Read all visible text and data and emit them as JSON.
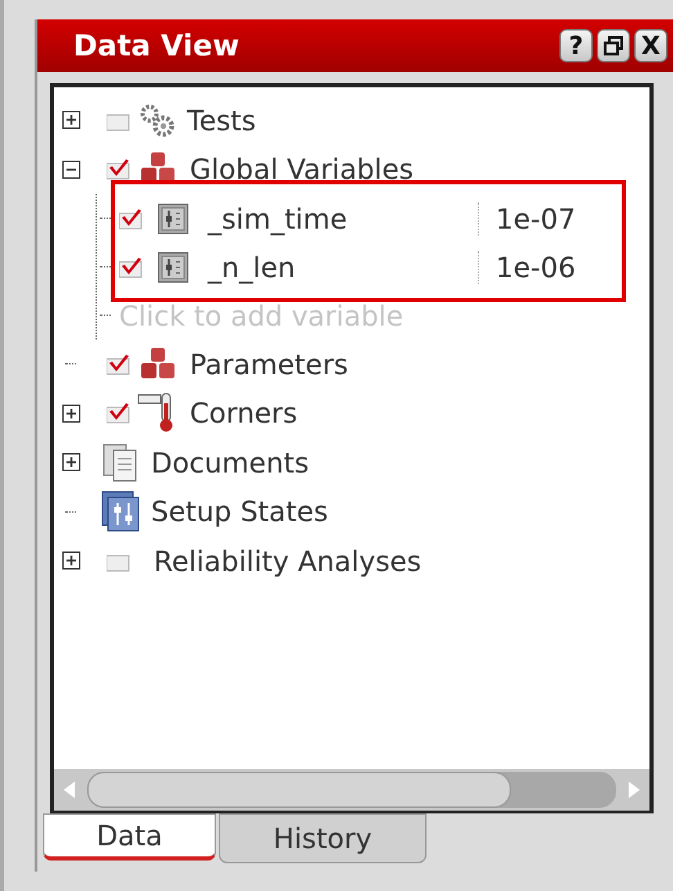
{
  "window": {
    "title": "Data View",
    "controls": [
      {
        "kind": "help",
        "label": "?"
      },
      {
        "kind": "restore"
      },
      {
        "kind": "close",
        "label": "X"
      }
    ]
  },
  "tree": {
    "items": [
      {
        "kind": "gears",
        "label": "Tests",
        "expanded": false,
        "checked": false
      },
      {
        "kind": "cubes",
        "label": "Global Variables",
        "expanded": true,
        "checked": true,
        "children": [
          {
            "kind": "variable",
            "label": "_sim_time",
            "value": "1e-07",
            "checked": true
          },
          {
            "kind": "variable",
            "label": "_n_len",
            "value": "1e-06",
            "checked": true
          },
          {
            "kind": "hint",
            "label": "Click to add variable"
          }
        ]
      },
      {
        "kind": "cubes",
        "label": "Parameters",
        "checked": true
      },
      {
        "kind": "thermometer",
        "label": "Corners",
        "expanded": false,
        "checked": true
      },
      {
        "kind": "documents",
        "label": "Documents",
        "expanded": false
      },
      {
        "kind": "setup",
        "label": "Setup States"
      },
      {
        "kind": "none",
        "label": "Reliability Analyses",
        "expanded": false,
        "checked": false
      }
    ]
  },
  "tabs": [
    {
      "label": "Data",
      "selected": true
    },
    {
      "label": "History",
      "selected": false
    }
  ]
}
